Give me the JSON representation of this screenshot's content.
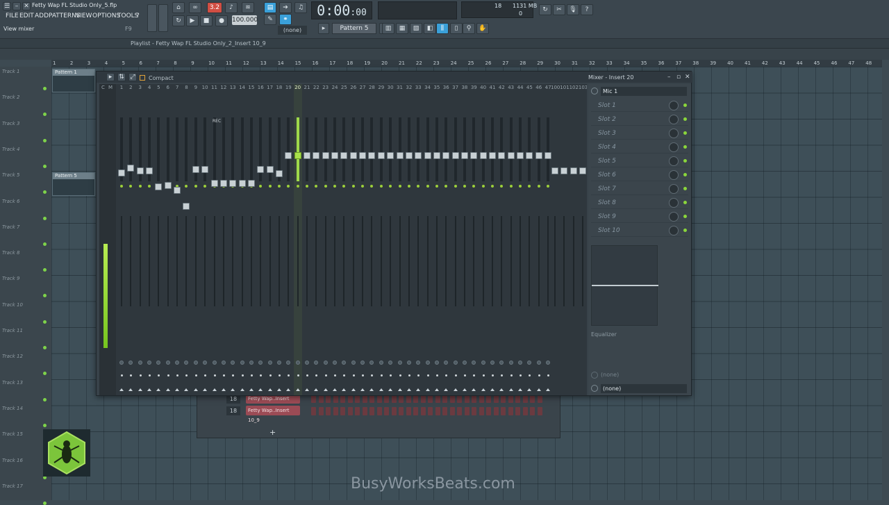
{
  "window": {
    "title": "Fetty Wap FL Studio Only_5.flp",
    "hint": "View mixer",
    "hint_key": "F9"
  },
  "menu": [
    "FILE",
    "EDIT",
    "ADD",
    "PATTERNS",
    "VIEW",
    "OPTIONS",
    "TOOLS",
    "?"
  ],
  "transport": {
    "time": "0:00",
    "time_small": ":00",
    "bpm": "100.000",
    "pattern": "Pattern 5",
    "none_select": "(none)",
    "pat_song_badge": "3.2"
  },
  "cpu": {
    "value_a": "18",
    "memory": "1131 MB",
    "value_c": "0"
  },
  "playlist": {
    "title": "Playlist - Fetty Wap FL Studio Only_2_Insert 10_9"
  },
  "ruler": [
    "1",
    "2",
    "3",
    "4",
    "5",
    "6",
    "7",
    "8",
    "9",
    "10",
    "11",
    "12",
    "13",
    "14",
    "15",
    "16",
    "17",
    "18",
    "19",
    "20",
    "21",
    "22",
    "23",
    "24",
    "25",
    "26",
    "27",
    "28",
    "29",
    "30",
    "31",
    "32",
    "33",
    "34",
    "35",
    "36",
    "37",
    "38",
    "39",
    "40",
    "41",
    "42",
    "43",
    "44",
    "45",
    "46",
    "47",
    "48"
  ],
  "tracks": [
    "Track 1",
    "Track 2",
    "Track 3",
    "Track 4",
    "Track 5",
    "Track 6",
    "Track 7",
    "Track 8",
    "Track 9",
    "Track 10",
    "Track 11",
    "Track 12",
    "Track 13",
    "Track 14",
    "Track 15",
    "Track 16",
    "Track 17"
  ],
  "clips": [
    "Pattern 1",
    "Pattern 5"
  ],
  "mixer": {
    "title": "Mixer - Insert 20",
    "compact_label": "Compact",
    "input": "Mic 1",
    "slots": [
      "Slot 1",
      "Slot 2",
      "Slot 3",
      "Slot 4",
      "Slot 5",
      "Slot 6",
      "Slot 7",
      "Slot 8",
      "Slot 9",
      "Slot 10"
    ],
    "eq_label": "Equalizer",
    "output_placeholder": "(none)",
    "output_value": "(none)",
    "master_labels": [
      "C",
      "M"
    ],
    "rec_label": "REC",
    "selected_insert": "20",
    "end_labels": [
      "100",
      "101",
      "102",
      "103"
    ]
  },
  "channel_rack": {
    "rows": [
      {
        "num": "18",
        "name": "Fetty Wap..Insert 10_9"
      },
      {
        "num": "18",
        "name": "Fetty Wap..Insert 10_9"
      }
    ]
  },
  "watermark": "BusyWorksBeats.com",
  "colors": {
    "accent_green": "#9fd94a",
    "clip_red": "#9b4b55",
    "background": "#3d4a52"
  }
}
